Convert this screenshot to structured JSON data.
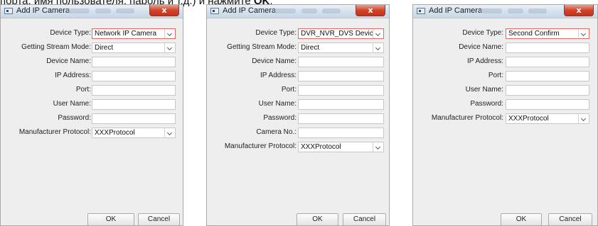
{
  "caption": {
    "text": "порта, имя пользователя, пароль и т.д.) и нажмите ",
    "bold": "OK"
  },
  "dialogs": [
    {
      "title": "Add IP Camera",
      "close_symbol": "x",
      "fields": [
        {
          "label": "Device Type:",
          "value": "Network IP Camera",
          "type": "select",
          "highlighted": true
        },
        {
          "label": "Getting Stream Mode:",
          "value": "Direct",
          "type": "select"
        },
        {
          "label": "Device Name:",
          "value": "",
          "type": "text"
        },
        {
          "label": "IP Address:",
          "value": "",
          "type": "text"
        },
        {
          "label": "Port:",
          "value": "",
          "type": "text"
        },
        {
          "label": "User Name:",
          "value": "",
          "type": "text"
        },
        {
          "label": "Password:",
          "value": "",
          "type": "text"
        },
        {
          "label": "Manufacturer Protocol:",
          "value": "XXXProtocol",
          "type": "select"
        }
      ],
      "ok_label": "OK",
      "cancel_label": "Cancel"
    },
    {
      "title": "Add IP Camera",
      "close_symbol": "x",
      "fields": [
        {
          "label": "Device Type:",
          "value": "DVR_NVR_DVS Device",
          "type": "select",
          "highlighted": true
        },
        {
          "label": "Getting Stream Mode:",
          "value": "Direct",
          "type": "select"
        },
        {
          "label": "Device Name:",
          "value": "",
          "type": "text"
        },
        {
          "label": "IP Address:",
          "value": "",
          "type": "text"
        },
        {
          "label": "Port:",
          "value": "",
          "type": "text"
        },
        {
          "label": "User Name:",
          "value": "",
          "type": "text"
        },
        {
          "label": "Password:",
          "value": "",
          "type": "text"
        },
        {
          "label": "Camera No.:",
          "value": "",
          "type": "text"
        },
        {
          "label": "Manufacturer Protocol:",
          "value": "XXXProtocol",
          "type": "select"
        }
      ],
      "ok_label": "OK",
      "cancel_label": "Cancel"
    },
    {
      "title": "Add IP Camera",
      "close_symbol": "x",
      "fields": [
        {
          "label": "Device Type:",
          "value": "Second Confirm",
          "type": "select",
          "highlighted": true
        },
        {
          "label": "Device Name:",
          "value": "",
          "type": "text"
        },
        {
          "label": "IP Address:",
          "value": "",
          "type": "text"
        },
        {
          "label": "Port:",
          "value": "",
          "type": "text"
        },
        {
          "label": "User Name:",
          "value": "",
          "type": "text"
        },
        {
          "label": "Password:",
          "value": "",
          "type": "text"
        },
        {
          "label": "Manufacturer Protocol:",
          "value": "XXXProtocol",
          "type": "select"
        }
      ],
      "ok_label": "OK",
      "cancel_label": "Cancel"
    }
  ]
}
